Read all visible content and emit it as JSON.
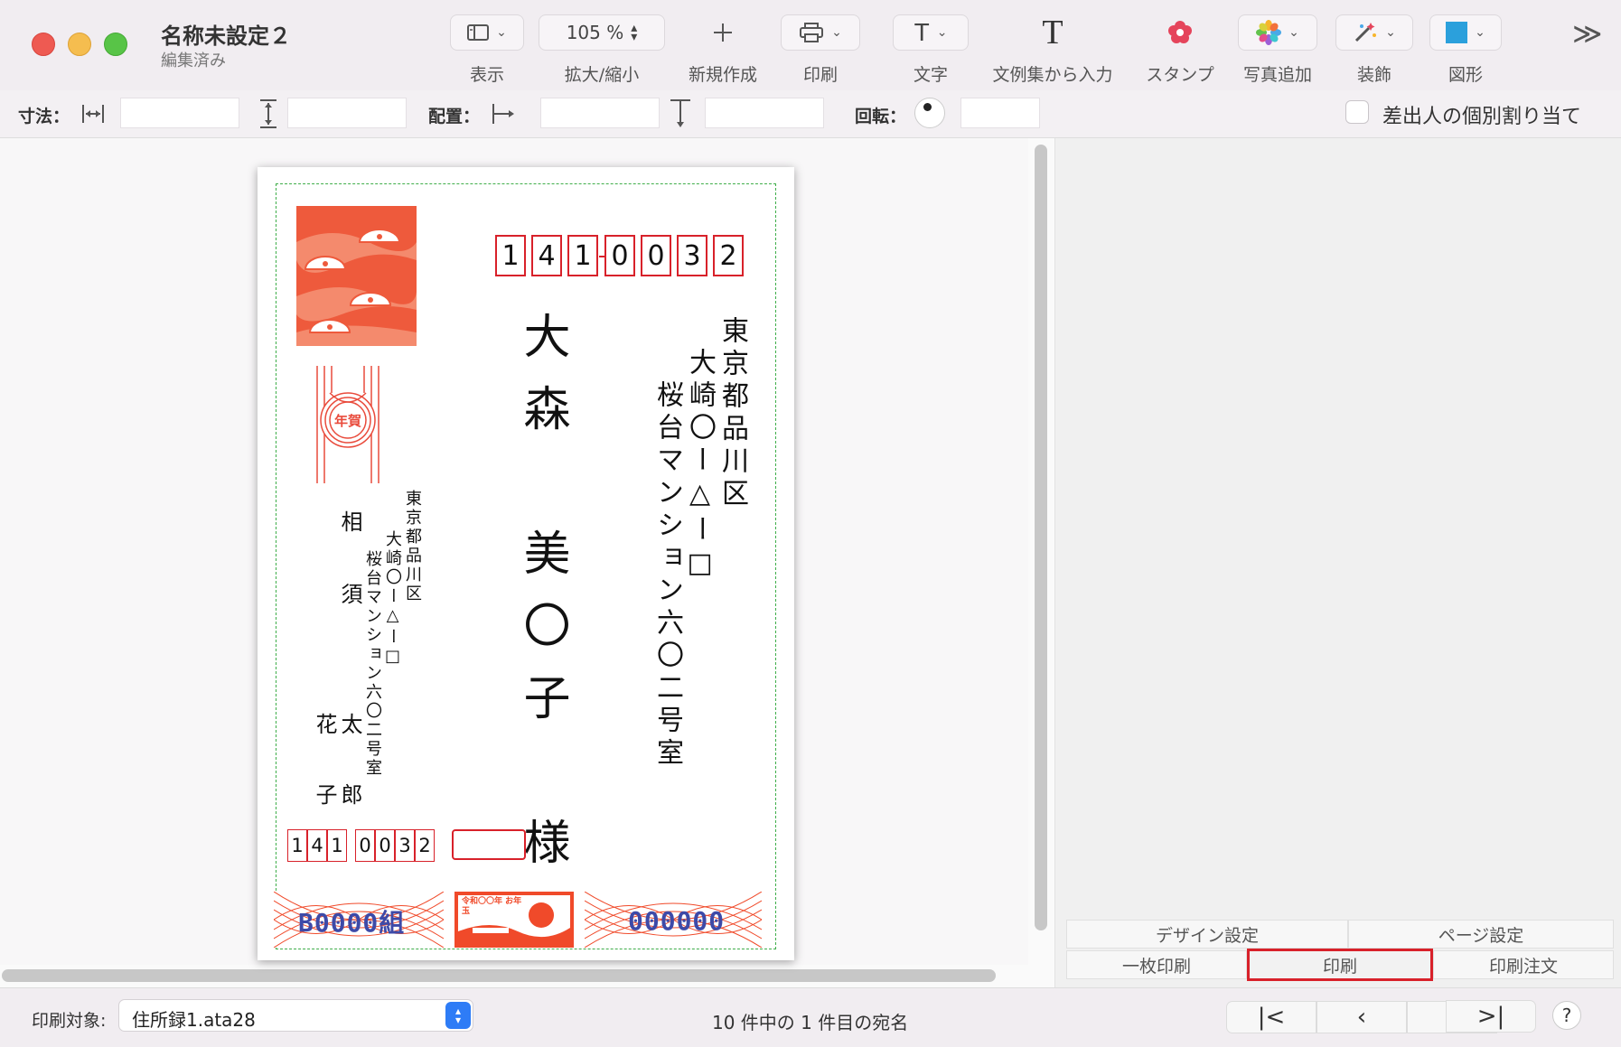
{
  "window": {
    "title": "名称未設定２",
    "subtitle": "編集済み"
  },
  "toolbar": {
    "view_label": "表示",
    "zoom_value": "105 %",
    "zoom_label": "拡大/縮小",
    "new_label": "新規作成",
    "print_label": "印刷",
    "text_label": "文字",
    "template_text_label": "文例集から入力",
    "stamp_label": "スタンプ",
    "photo_label": "写真追加",
    "decor_label": "装飾",
    "shape_label": "図形",
    "more_label": "≫"
  },
  "format_bar": {
    "size_label": "寸法：",
    "position_label": "配置：",
    "rotation_label": "回転：",
    "individual_sender_label": "差出人の個別割り当て"
  },
  "postcard": {
    "recipient_zip": [
      "1",
      "4",
      "1",
      "0",
      "0",
      "3",
      "2"
    ],
    "recipient_address_line1": "東京都品川区",
    "recipient_address_line2": "大崎〇ー△ー□",
    "recipient_address_line3": "桜台マンション六〇二号室",
    "recipient_name": "大森　美〇子　様",
    "sender_address_line1": "東京都品川区",
    "sender_address_line2": "大崎〇ー△ー□",
    "sender_address_line3": "桜台マンション六〇二号室",
    "sender_family_name": "相須",
    "sender_given_name_1": "太郎",
    "sender_given_name_2": "花子",
    "sender_zip": [
      "1",
      "4",
      "1",
      "0",
      "0",
      "3",
      "2"
    ],
    "nenga_mark": "年賀",
    "lottery_group": "B0000組",
    "lottery_number": "000000",
    "stamp_text": "令和〇〇年 お年玉"
  },
  "right_pane": {
    "tabs_row1": [
      "デザイン設定",
      "ページ設定"
    ],
    "tabs_row2": [
      "一枚印刷",
      "印刷",
      "印刷注文"
    ]
  },
  "status_bar": {
    "target_label": "印刷対象:",
    "target_value": "住所録1.ata28",
    "count_text": "10 件中の 1 件目の宛名",
    "help": "?"
  },
  "colors": {
    "accent_red": "#d8212a",
    "guide_green": "#3fae4a",
    "serial_blue": "#3d4aa8",
    "stamp_red": "#f04a2a"
  }
}
